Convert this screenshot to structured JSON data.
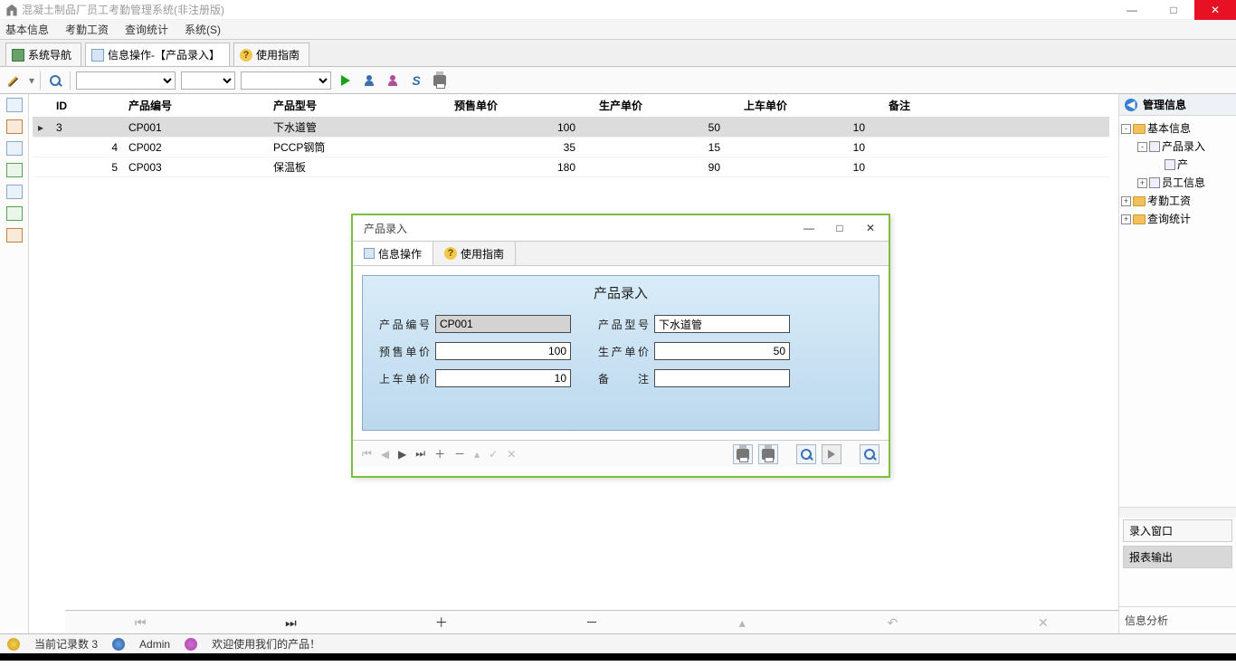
{
  "window": {
    "title": "混凝土制品厂员工考勤管理系统(非注册版)"
  },
  "menubar": [
    "基本信息",
    "考勤工资",
    "查询统计",
    "系统(S)"
  ],
  "maintabs": {
    "nav": "系统导航",
    "active": "信息操作-【产品录入】",
    "help": "使用指南"
  },
  "grid": {
    "columns": [
      "ID",
      "产品编号",
      "产品型号",
      "预售单价",
      "生产单价",
      "上车单价",
      "备注"
    ],
    "rows": [
      {
        "id": "3",
        "code": "CP001",
        "model": "下水道管",
        "presale": "100",
        "produce": "50",
        "load": "10",
        "remark": ""
      },
      {
        "id": "4",
        "code": "CP002",
        "model": "PCCP钢筒",
        "presale": "35",
        "produce": "15",
        "load": "10",
        "remark": ""
      },
      {
        "id": "5",
        "code": "CP003",
        "model": "保温板",
        "presale": "180",
        "produce": "90",
        "load": "10",
        "remark": ""
      }
    ],
    "selected_row": 0
  },
  "right": {
    "title": "管理信息",
    "tree": {
      "basic": "基本信息",
      "prod_entry": "产品录入",
      "prod_sub": "产",
      "emp_info": "员工信息",
      "kq": "考勤工资",
      "cx": "查询统计"
    },
    "btn_entry": "录入窗口",
    "btn_report": "报表输出",
    "footer": "信息分析"
  },
  "status": {
    "count_label": "当前记录数",
    "count_value": "3",
    "user": "Admin",
    "welcome": "欢迎使用我们的产品！"
  },
  "dialog": {
    "title": "产品录入",
    "tab_info": "信息操作",
    "tab_help": "使用指南",
    "form_title": "产品录入",
    "labels": {
      "code": "产品编号",
      "model": "产品型号",
      "presale": "预售单价",
      "produce": "生产单价",
      "load": "上车单价",
      "remark": "备    注"
    },
    "values": {
      "code": "CP001",
      "model": "下水道管",
      "presale": "100",
      "produce": "50",
      "load": "10",
      "remark": ""
    }
  }
}
